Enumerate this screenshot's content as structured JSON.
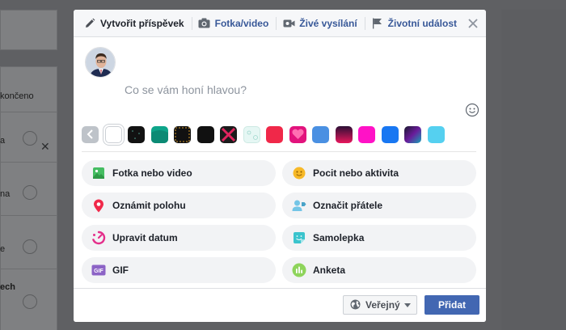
{
  "background_page": {
    "texts": [
      "končeno",
      "a",
      "na",
      "e",
      "ech"
    ]
  },
  "composer": {
    "tabs": [
      {
        "label": "Vytvořit příspěvek",
        "icon": "pencil-icon"
      },
      {
        "label": "Fotka/video",
        "icon": "camera-icon"
      },
      {
        "label": "Živé vysílání",
        "icon": "video-camera-icon"
      },
      {
        "label": "Životní událost",
        "icon": "flag-icon"
      }
    ],
    "placeholder": "Co se vám honí hlavou?",
    "background_swatches": [
      "#e9ebee",
      "#121212",
      "#0ea58a",
      "#2a1b0e",
      "#111111",
      "#1b1b1b",
      "#d9f2ee",
      "#f02849",
      "#e2137d",
      "#4a90e2",
      "#e8175d",
      "#ff12c6",
      "#1877f2",
      "#6a1b9a",
      "#55d0f0"
    ],
    "actions": [
      {
        "label": "Fotka nebo video",
        "icon": "photo-icon",
        "color": "#45bd62"
      },
      {
        "label": "Pocit nebo aktivita",
        "icon": "smiley-icon",
        "color": "#f7b928"
      },
      {
        "label": "Oznámit polohu",
        "icon": "location-pin-icon",
        "color": "#f02849"
      },
      {
        "label": "Označit přátele",
        "icon": "tag-friends-icon",
        "color": "#73c5e6"
      },
      {
        "label": "Upravit datum",
        "icon": "calendar-clock-icon",
        "color": "#e42f8b"
      },
      {
        "label": "Samolepka",
        "icon": "sticker-icon",
        "color": "#3bc4cd"
      },
      {
        "label": "GIF",
        "icon": "gif-icon",
        "color": "#8c63c6"
      },
      {
        "label": "Anketa",
        "icon": "poll-icon",
        "color": "#8ed45b"
      }
    ],
    "footer": {
      "audience": "Veřejný",
      "submit": "Přidat"
    }
  }
}
